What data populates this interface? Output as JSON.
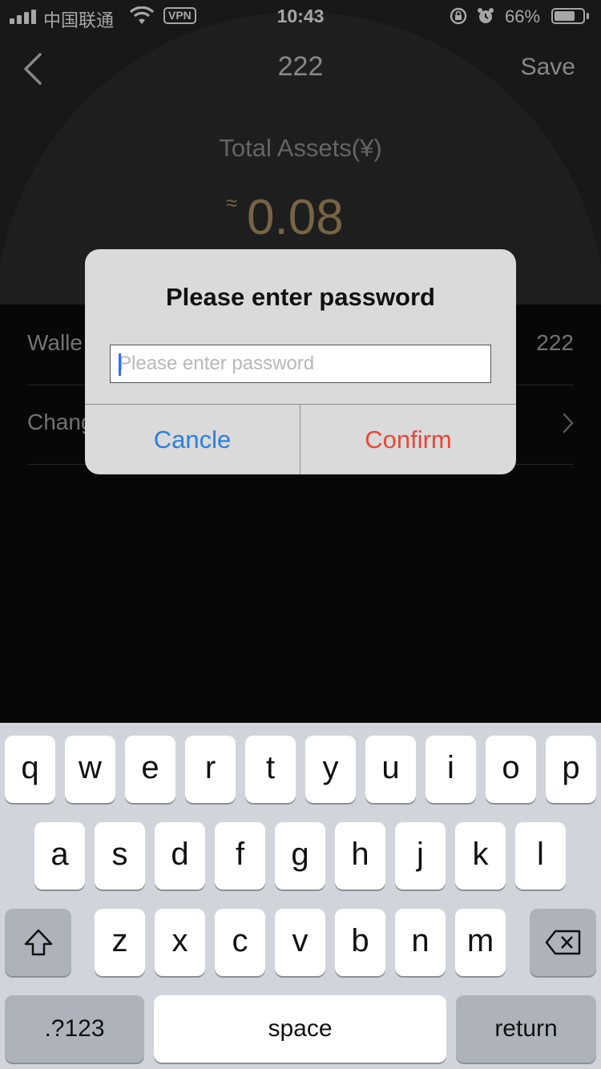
{
  "status_bar": {
    "carrier": "中国联通",
    "vpn": "VPN",
    "time": "10:43",
    "battery": "66%",
    "battery_level": 0.66
  },
  "nav": {
    "title": "222",
    "save": "Save"
  },
  "assets": {
    "label": "Total Assets(¥)",
    "approx": "≈",
    "value": "0.08"
  },
  "list": [
    {
      "label": "Walle",
      "value": "222"
    },
    {
      "label": "Chang"
    }
  ],
  "dialog": {
    "title": "Please enter password",
    "placeholder": "Please enter password",
    "cancel": "Cancle",
    "confirm": "Confirm"
  },
  "keyboard": {
    "row1": [
      "q",
      "w",
      "e",
      "r",
      "t",
      "y",
      "u",
      "i",
      "o",
      "p"
    ],
    "row2": [
      "a",
      "s",
      "d",
      "f",
      "g",
      "h",
      "j",
      "k",
      "l"
    ],
    "row3": [
      "z",
      "x",
      "c",
      "v",
      "b",
      "n",
      "m"
    ],
    "numbers": ".?123",
    "space": "space",
    "return": "return"
  },
  "colors": {
    "accent_gold": "#b59a68",
    "cancel_blue": "#2b7fe0",
    "confirm_red": "#e8463a"
  }
}
